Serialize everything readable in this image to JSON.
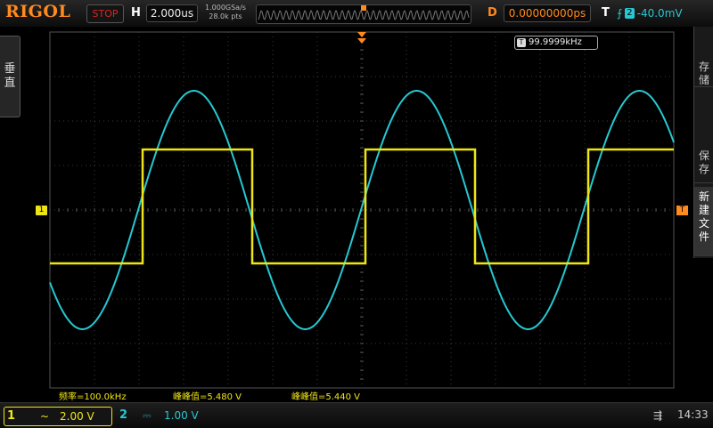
{
  "header": {
    "brand": "RIGOL",
    "run_state": "STOP",
    "horizontal_label": "H",
    "timebase": "2.000us",
    "sample_rate": "1.000GSa/s",
    "memory_depth": "28.0k pts",
    "delay_label": "D",
    "delay": "0.00000000ps",
    "trigger_label": "T",
    "trigger_edge_icon": "rising-edge-icon",
    "trigger_source": "2",
    "trigger_level": "-40.0mV"
  },
  "side_tab": {
    "label": "垂\n直"
  },
  "right_menu": {
    "items": [
      "存\n储",
      "保\n存",
      "新\n建\n文\n件"
    ]
  },
  "markers": {
    "ch1": "1",
    "trigger": "T"
  },
  "frequency_counter": {
    "icon": "T",
    "value": "99.9999kHz"
  },
  "measurements": {
    "m1": "频率=100.0kHz",
    "m2": "峰峰值=5.480 V",
    "m3": "峰峰值=5.440 V"
  },
  "channels": {
    "ch1": {
      "number": "1",
      "coupling_icon": "~",
      "scale": "2.00 V"
    },
    "ch2": {
      "number": "2",
      "coupling_icon": "⎓",
      "scale": "1.00 V"
    }
  },
  "status": {
    "usb_icon": "usb-icon",
    "time": "14:33"
  },
  "colors": {
    "ch1": "#f0e514",
    "ch2": "#26c8d2",
    "accent": "#ff8a1e",
    "stop": "#e0261c"
  }
}
